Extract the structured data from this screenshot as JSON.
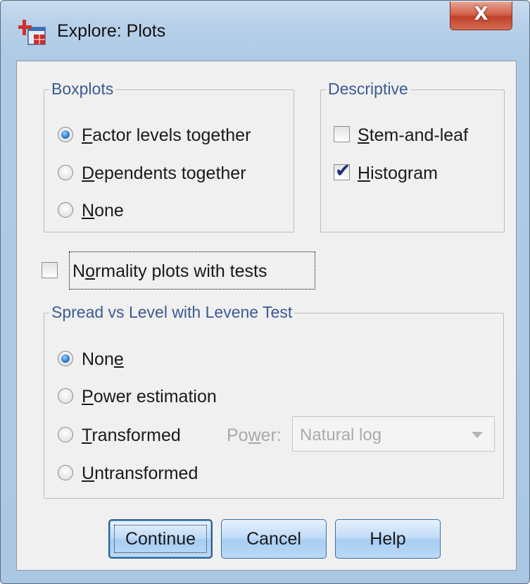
{
  "window": {
    "title": "Explore: Plots",
    "close_label": "X"
  },
  "boxplots": {
    "legend": "Boxplots",
    "options": [
      {
        "label": "Factor levels together",
        "mnemonic_index": 0,
        "selected": true
      },
      {
        "label": "Dependents together",
        "mnemonic_index": 0,
        "selected": false
      },
      {
        "label": "None",
        "mnemonic_index": 0,
        "selected": false
      }
    ]
  },
  "descriptive": {
    "legend": "Descriptive",
    "options": [
      {
        "label": "Stem-and-leaf",
        "mnemonic_index": 0,
        "checked": false
      },
      {
        "label": "Histogram",
        "mnemonic_index": 0,
        "checked": true
      }
    ]
  },
  "normality": {
    "label": "Normality plots with tests",
    "mnemonic_index": 1,
    "checked": false
  },
  "spread": {
    "legend": "Spread vs Level with Levene Test",
    "options": [
      {
        "label": "None",
        "mnemonic_index": 3,
        "selected": true
      },
      {
        "label": "Power estimation",
        "mnemonic_index": 0,
        "selected": false
      },
      {
        "label": "Transformed",
        "mnemonic_index": 0,
        "selected": false
      },
      {
        "label": "Untransformed",
        "mnemonic_index": 0,
        "selected": false
      }
    ],
    "power_label": "Power:",
    "power_value": "Natural log"
  },
  "buttons": {
    "continue": "Continue",
    "cancel": "Cancel",
    "help": "Help"
  },
  "colors": {
    "legend_text": "#3c5a93",
    "disabled_text": "#a9a9a9"
  }
}
